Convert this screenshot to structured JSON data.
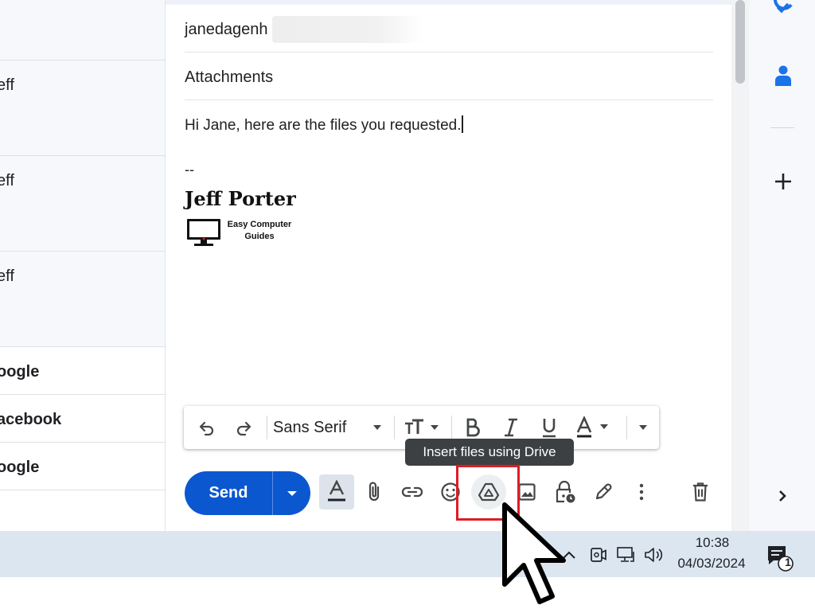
{
  "inbox": {
    "rows": [
      {
        "sender": "eff"
      },
      {
        "sender": "eff"
      },
      {
        "sender": "eff"
      },
      {
        "sender": "oogle"
      },
      {
        "sender": "acebook"
      },
      {
        "sender": "oogle"
      }
    ]
  },
  "compose": {
    "to_value": "janedagenh",
    "subject": "Attachments",
    "body": "Hi Jane, here are the files you requested.",
    "signature": {
      "dash": "--",
      "name": "Jeff Porter",
      "logo_line1": "Easy Computer",
      "logo_line2": "Guides"
    },
    "format_toolbar": {
      "font_family": "Sans Serif"
    },
    "tooltip": "Insert files using Drive",
    "send_label": "Send"
  },
  "taskbar": {
    "time": "10:38",
    "date": "04/03/2024",
    "notification_count": "1"
  },
  "colors": {
    "send_blue": "#0b57d0",
    "highlight_red": "#e01b22",
    "taskbar": "#dbe6f1"
  }
}
